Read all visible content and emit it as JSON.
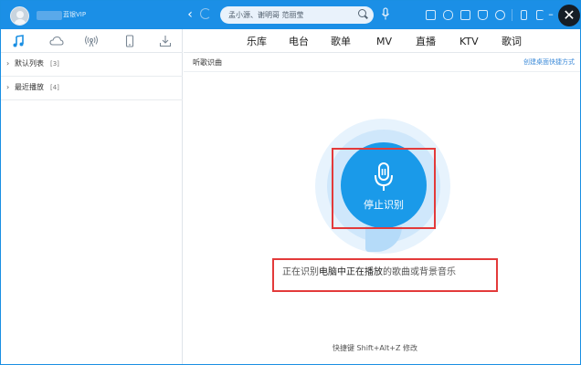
{
  "titlebar": {
    "username": "蓝银VIP",
    "search_placeholder": "孟小源、谢明哥 范丽莹"
  },
  "sidebar": {
    "tabs": [
      {
        "icon": "music-note-icon"
      },
      {
        "icon": "cloud-icon"
      },
      {
        "icon": "radio-icon"
      },
      {
        "icon": "phone-icon"
      },
      {
        "icon": "download-icon"
      }
    ],
    "playlists": [
      {
        "name": "默认列表",
        "count": "[3]"
      },
      {
        "name": "最近播放",
        "count": "[4]"
      }
    ]
  },
  "topnav": {
    "items": [
      "乐库",
      "电台",
      "歌单",
      "MV",
      "直播",
      "KTV",
      "歌词"
    ]
  },
  "main": {
    "page_title": "听歌识曲",
    "shortcut_link": "创建桌面快捷方式",
    "button_label": "停止识别",
    "status_part1": "正在识别",
    "status_part2": "电脑中正在播放",
    "status_part3": "的歌曲或背景音乐",
    "hotkey_label": "快捷键",
    "hotkey_value": "Shift+Alt+Z",
    "hotkey_action": "修改"
  },
  "colors": {
    "titlebar": "#1b8fe6",
    "accent": "#1a9ae9",
    "highlight_box": "#e33a3a"
  }
}
